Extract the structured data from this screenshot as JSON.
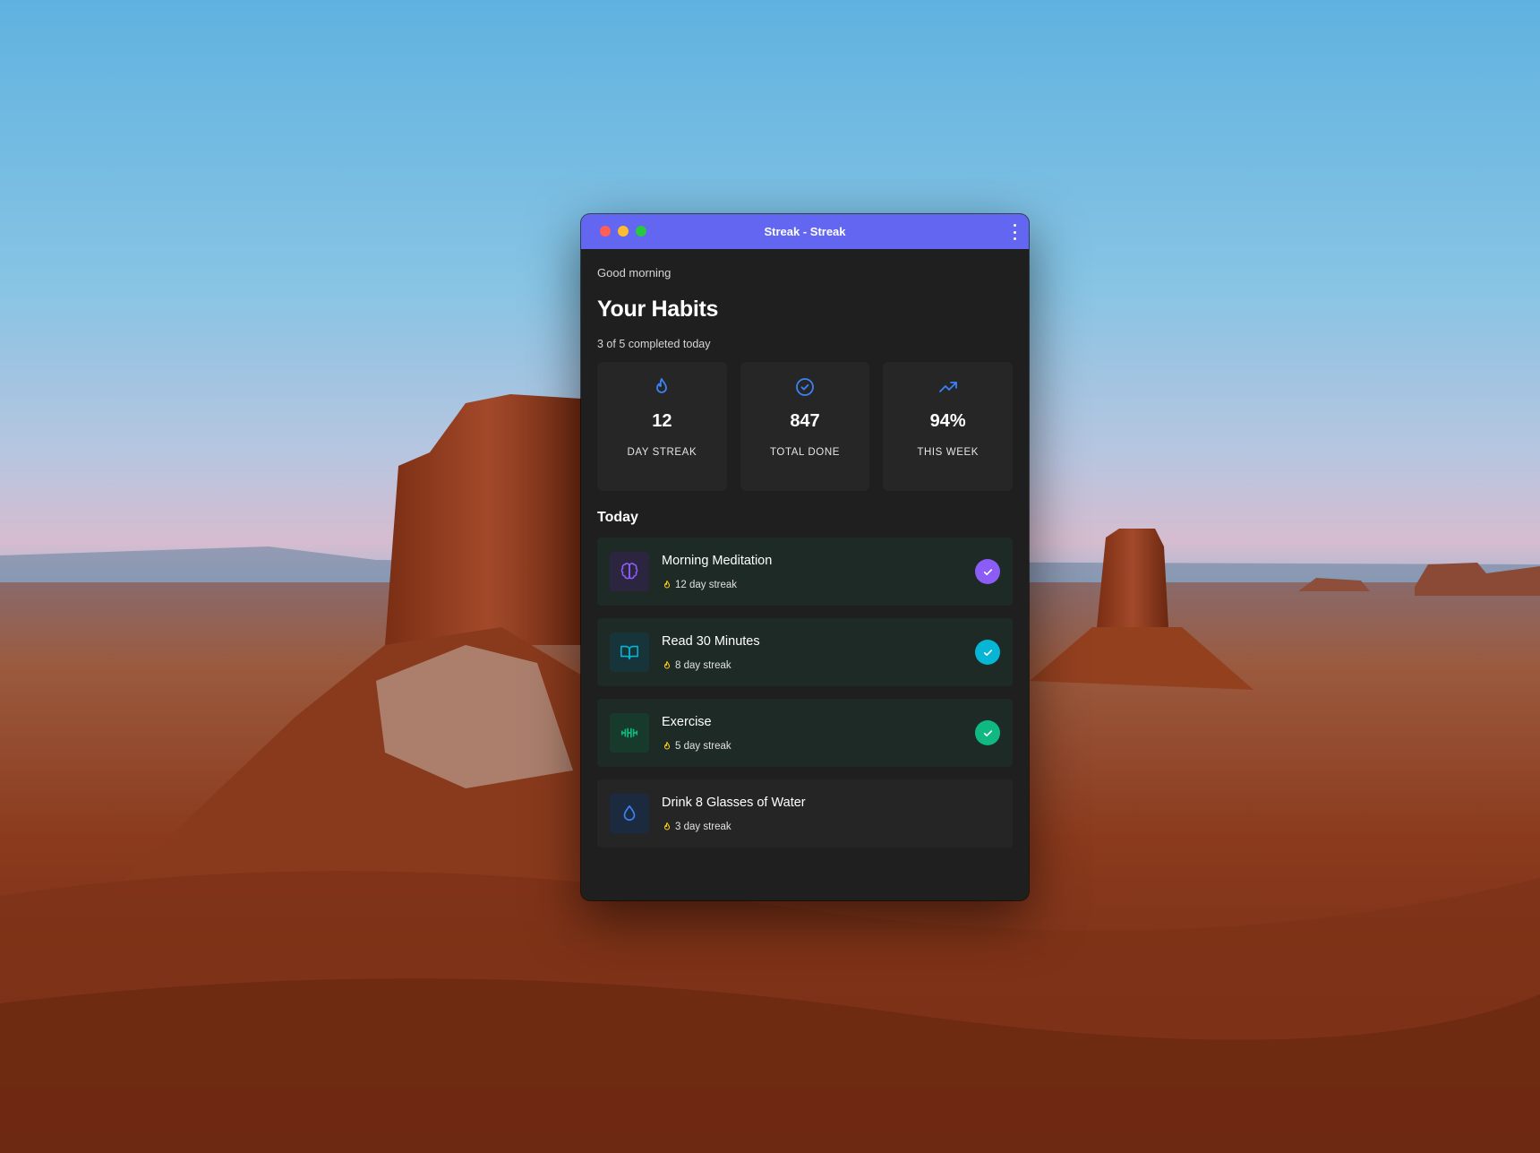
{
  "window": {
    "title": "Streak - Streak"
  },
  "header": {
    "greeting": "Good morning",
    "title": "Your Habits",
    "progress": "3 of 5 completed today"
  },
  "stats": [
    {
      "icon": "flame-icon",
      "value": "12",
      "label": "DAY STREAK"
    },
    {
      "icon": "check-circle-icon",
      "value": "847",
      "label": "TOTAL DONE"
    },
    {
      "icon": "trending-up-icon",
      "value": "94%",
      "label": "THIS WEEK"
    }
  ],
  "today": {
    "title": "Today",
    "habits": [
      {
        "name": "Morning Meditation",
        "streak": "12 day streak",
        "icon": "brain-icon",
        "done": true,
        "color": "#8b5cf6"
      },
      {
        "name": "Read 30 Minutes",
        "streak": "8 day streak",
        "icon": "book-icon",
        "done": true,
        "color": "#06b6d4"
      },
      {
        "name": "Exercise",
        "streak": "5 day streak",
        "icon": "dumbbell-icon",
        "done": true,
        "color": "#10b981"
      },
      {
        "name": "Drink 8 Glasses of Water",
        "streak": "3 day streak",
        "icon": "droplet-icon",
        "done": false,
        "color": "#3b82f6"
      }
    ]
  },
  "colors": {
    "titlebar": "#6366f1",
    "stat_icon": "#3b82f6",
    "streak_flame": "#facc15"
  }
}
